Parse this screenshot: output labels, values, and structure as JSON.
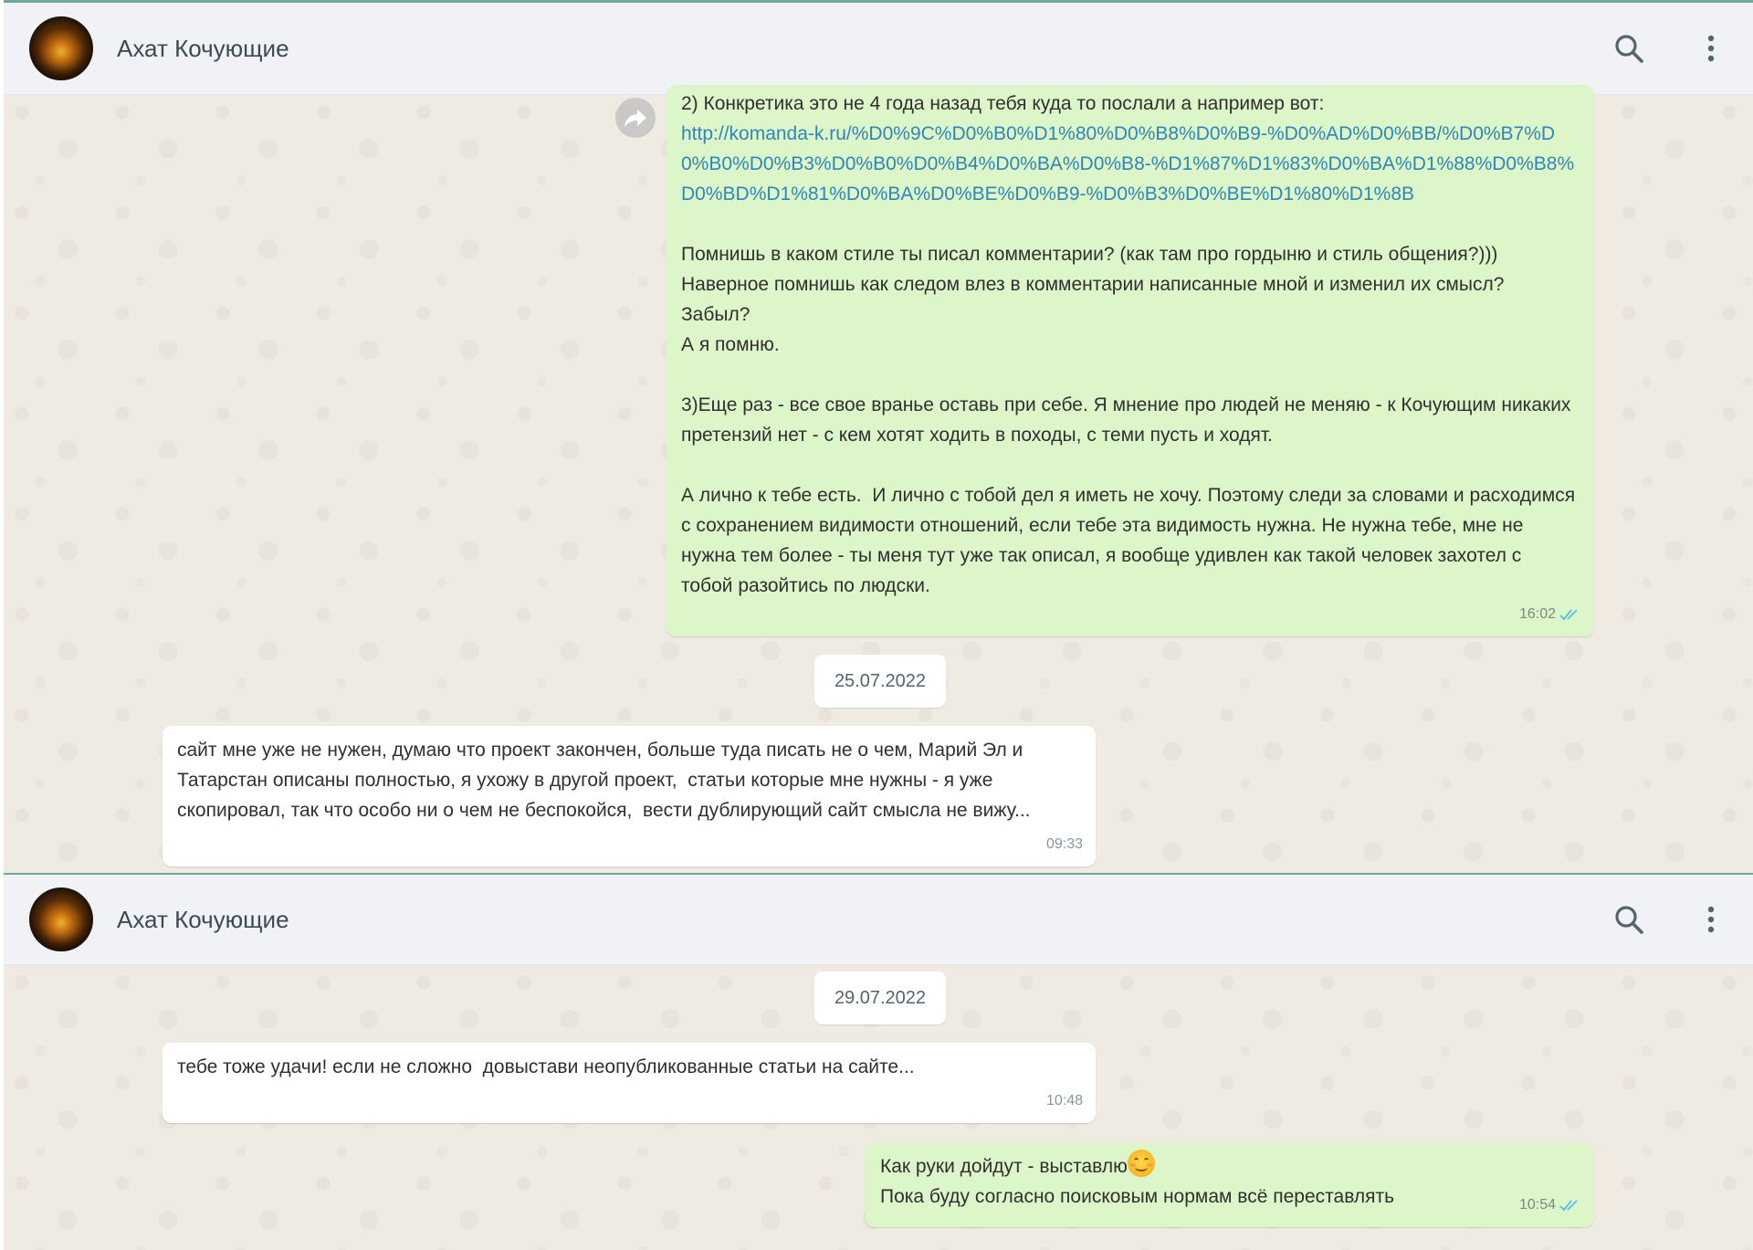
{
  "colors": {
    "outgoing_bubble": "#dcf6c9",
    "incoming_bubble": "#ffffff",
    "link": "#2f86b8",
    "tick": "#53bdeb"
  },
  "panels": [
    {
      "header": {
        "contact_name": "Ахат Кочующие"
      },
      "messages": [
        {
          "direction": "out",
          "forwarded": true,
          "text_intro": "2) Конкретика это не 4 года назад тебя куда то послали а например вот:",
          "link": "http://komanda-k.ru/%D0%9C%D0%B0%D1%80%D0%B8%D0%B9-%D0%AD%D0%BB/%D0%B7%D0%B0%D0%B3%D0%B0%D0%B4%D0%BA%D0%B8-%D1%87%D1%83%D0%BA%D1%88%D0%B8%D0%BD%D1%81%D0%BA%D0%BE%D0%B9-%D0%B3%D0%BE%D1%80%D1%8B",
          "text_body": "\nПомнишь в каком стиле ты писал комментарии? (как там про гордыню и стиль общения?))) Наверное помнишь как следом влез в комментарии написанные мной и изменил их смысл? Забыл?\nА я помню.\n\n3)Еще раз - все свое вранье оставь при себе. Я мнение про людей не меняю - к Кочующим никаких претензий нет - с кем хотят ходить в походы, с теми пусть и ходят.\n\nА лично к тебе есть.  И лично с тобой дел я иметь не хочу. Поэтому следи за словами и расходимся с сохранением видимости отношений, если тебе эта видимость нужна. Не нужна тебе, мне не нужна тем более - ты меня тут уже так описал, я вообще удивлен как такой человек захотел с тобой разойтись по людски.",
          "time": "16:02",
          "status_icon": "double-check-icon"
        },
        {
          "type": "date",
          "label": "25.07.2022"
        },
        {
          "direction": "in",
          "text": "сайт мне уже не нужен, думаю что проект закончен, больше туда писать не о чем, Марий Эл и Татарстан описаны полностью, я ухожу в другой проект,  статьи которые мне нужны - я уже скопировал, так что особо ни о чем не беспокойся,  вести дублирующий сайт смысла не вижу...",
          "time": "09:33"
        }
      ]
    },
    {
      "header": {
        "contact_name": "Ахат Кочующие"
      },
      "messages": [
        {
          "type": "date",
          "label": "29.07.2022"
        },
        {
          "direction": "in",
          "text": "тебе тоже удачи! если не сложно  довыстави неопубликованные статьи на сайте...",
          "time": "10:48"
        },
        {
          "direction": "out",
          "line1": "Как руки дойдут - выставлю",
          "emoji": "smiling-face-emoji",
          "line2": "Пока буду согласно поисковым нормам всё переставлять",
          "time": "10:54",
          "status_icon": "double-check-icon"
        }
      ]
    }
  ]
}
